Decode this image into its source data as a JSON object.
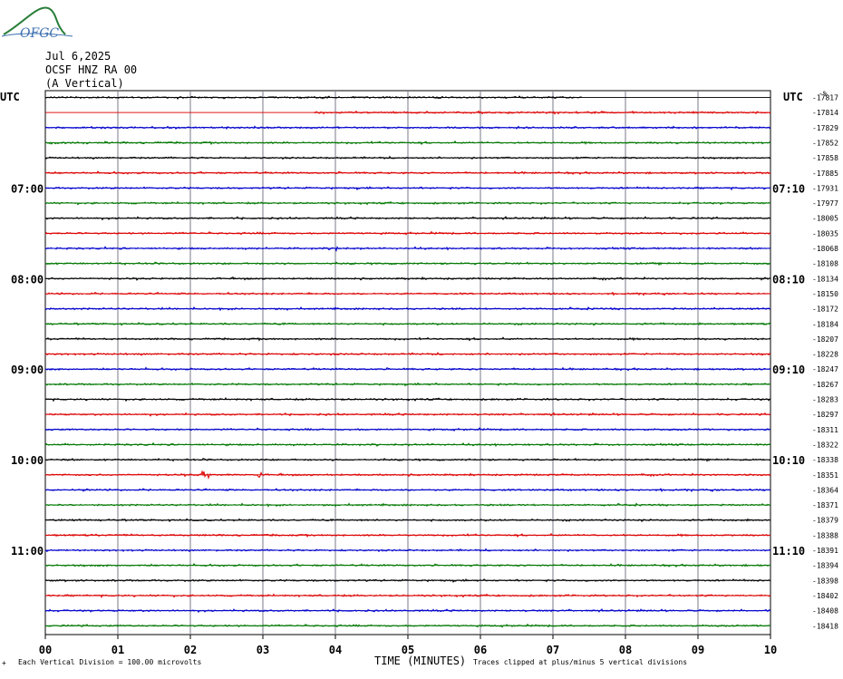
{
  "logo": {
    "text": "OFGC",
    "color": "#2a7f3b"
  },
  "header": {
    "date": "Jul 6,2025",
    "station": "OCSF HNZ RA 00",
    "component": "(A Vertical)"
  },
  "left_tz": "UTC",
  "right_tz": "UTC",
  "right_unit": "-%",
  "footer": {
    "corner_mark": "+",
    "scale": "Each Vertical Division =  100.00 microvolts",
    "clip": "Traces clipped at plus/minus 5 vertical divisions"
  },
  "chart_data": {
    "type": "line",
    "title": "",
    "xlabel": "TIME (MINUTES)",
    "ylabel": "",
    "xlim": [
      0,
      10
    ],
    "x_ticks": [
      "00",
      "01",
      "02",
      "03",
      "04",
      "05",
      "06",
      "07",
      "08",
      "09",
      "10"
    ],
    "trace_colors": [
      "#000000",
      "#dd0000",
      "#0000cc",
      "#007700"
    ],
    "left_hour_labels": [
      {
        "trace": 6,
        "label": "07:00"
      },
      {
        "trace": 12,
        "label": "08:00"
      },
      {
        "trace": 18,
        "label": "09:00"
      },
      {
        "trace": 24,
        "label": "10:00"
      },
      {
        "trace": 30,
        "label": "11:00"
      }
    ],
    "right_hour_labels": [
      {
        "trace": 6,
        "label": "07:10"
      },
      {
        "trace": 12,
        "label": "08:10"
      },
      {
        "trace": 18,
        "label": "09:10"
      },
      {
        "trace": 24,
        "label": "10:10"
      },
      {
        "trace": 30,
        "label": "11:10"
      }
    ],
    "trace_offsets": [
      "-17817",
      "-17814",
      "-17829",
      "-17852",
      "-17858",
      "-17885",
      "-17931",
      "-17977",
      "-18005",
      "-18035",
      "-18068",
      "-18108",
      "-18134",
      "-18150",
      "-18172",
      "-18184",
      "-18207",
      "-18228",
      "-18247",
      "-18267",
      "-18283",
      "-18297",
      "-18311",
      "-18322",
      "-18338",
      "-18351",
      "-18364",
      "-18371",
      "-18379",
      "-18388",
      "-18391",
      "-18394",
      "-18398",
      "-18402",
      "-18408",
      "-18418"
    ],
    "trace_end_minutes": [
      7.4,
      10,
      10,
      10,
      10,
      10,
      10,
      10,
      10,
      10,
      10,
      10,
      10,
      10,
      10,
      10,
      10,
      10,
      10,
      10,
      10,
      10,
      10,
      10,
      10,
      10,
      10,
      10,
      10,
      10,
      10,
      10,
      10,
      10,
      10,
      10
    ],
    "trace_start_minutes": [
      0,
      3.7,
      0,
      0,
      0,
      0,
      0,
      0,
      0,
      0,
      0,
      0,
      0,
      0,
      0,
      0,
      0,
      0,
      0,
      0,
      0,
      0,
      0,
      0,
      0,
      0,
      0,
      0,
      0,
      0,
      0,
      0,
      0,
      0,
      0,
      0
    ],
    "events": [
      {
        "trace": 25,
        "minute": 2.2,
        "amplitude": 0.6
      },
      {
        "trace": 25,
        "minute": 2.95,
        "amplitude": 0.4
      },
      {
        "trace": 10,
        "minute": 4.0,
        "amplitude": 0.4
      }
    ],
    "grid": true
  }
}
